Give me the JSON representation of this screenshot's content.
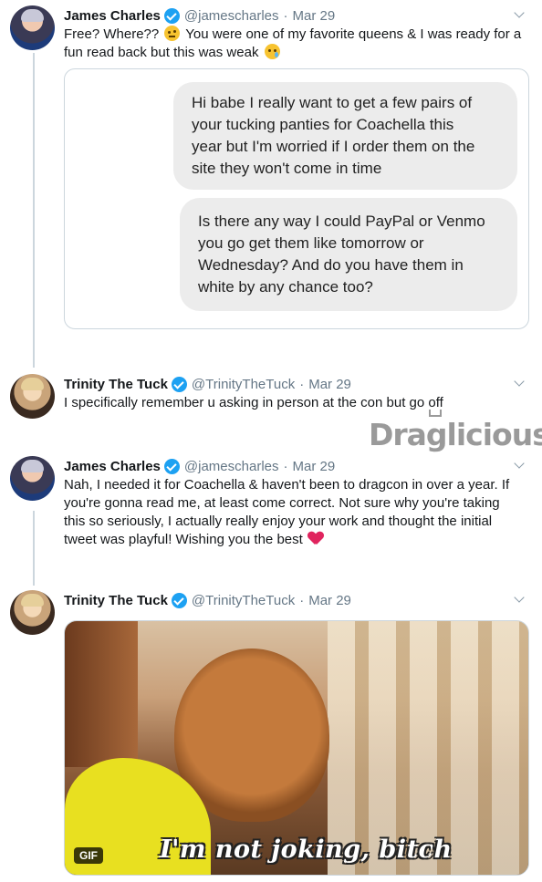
{
  "tweets": [
    {
      "name": "James Charles",
      "handle": "@jamescharles",
      "separator": "·",
      "date": "Mar 29",
      "text_line1": "Free? Where?? ",
      "text_line1b": " You were one of my favorite queens & I was ready for a",
      "text_line2": "fun read back but this was weak "
    },
    {
      "name": "Trinity The Tuck",
      "handle": "@TrinityTheTuck",
      "separator": "·",
      "date": "Mar 29",
      "text": "I specifically remember u asking in person at the con but go off"
    },
    {
      "name": "James Charles",
      "handle": "@jamescharles",
      "separator": "·",
      "date": "Mar 29",
      "lines": [
        "Nah, I needed it for Coachella & haven't been to dragcon in over a year. If",
        "you're gonna read me, at least come correct. Not sure why you're taking",
        "this so seriously, I actually really enjoy your work and thought the initial",
        "tweet was playful! Wishing you the best "
      ]
    },
    {
      "name": "Trinity The Tuck",
      "handle": "@TrinityTheTuck",
      "separator": "·",
      "date": "Mar 29"
    }
  ],
  "quoted_messages": [
    {
      "lines": [
        "Hi babe I really want to get a few pairs of",
        "your tucking panties for Coachella this",
        "year but I'm worried if I order them on the",
        "site they won't come in time"
      ]
    },
    {
      "lines": [
        "Is there any way I could PayPal or Venmo",
        "you go get them like tomorrow or",
        "Wednesday? And do you have them in",
        "white by any chance too?"
      ]
    }
  ],
  "watermark": "Draglicious",
  "gif": {
    "badge": "GIF",
    "caption": "I'm not joking, bitch"
  },
  "icons": [
    "verified-badge-icon",
    "chevron-down-icon",
    "face-with-raised-eyebrow-emoji",
    "crying-face-emoji",
    "red-heart-emoji"
  ],
  "colors": {
    "verified": "#1da1f2",
    "muted_text": "#657786",
    "thread_line": "#ccd6dd",
    "heart": "#e0245e"
  }
}
